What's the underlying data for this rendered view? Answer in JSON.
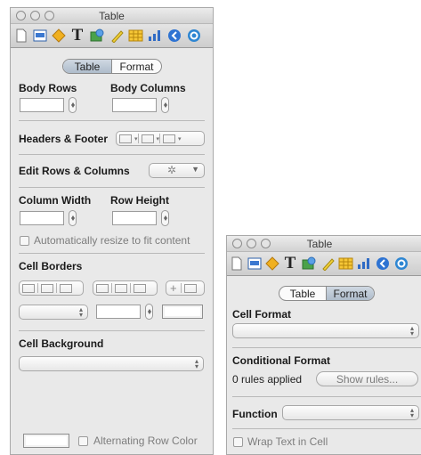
{
  "panel1": {
    "title": "Table",
    "tabs": [
      "Table",
      "Format"
    ],
    "selected_tab": "Table",
    "body_rows_label": "Body Rows",
    "body_rows_value": "",
    "body_columns_label": "Body Columns",
    "body_columns_value": "",
    "headers_footer_label": "Headers & Footer",
    "edit_rows_label": "Edit Rows & Columns",
    "column_width_label": "Column Width",
    "column_width_value": "",
    "row_height_label": "Row Height",
    "row_height_value": "",
    "auto_resize_label": "Automatically resize to fit content",
    "cell_borders_label": "Cell Borders",
    "border_width_value": "",
    "cell_background_label": "Cell Background",
    "alternating_label": "Alternating Row Color"
  },
  "panel2": {
    "title": "Table",
    "tabs": [
      "Table",
      "Format"
    ],
    "selected_tab": "Format",
    "cell_format_label": "Cell Format",
    "conditional_format_label": "Conditional Format",
    "rules_applied_text": "0 rules applied",
    "show_rules_label": "Show rules...",
    "function_label": "Function",
    "wrap_text_label": "Wrap Text in Cell"
  },
  "toolbar_icons": [
    "document-icon",
    "layout-icon",
    "graphic-icon",
    "text-icon",
    "wrap-icon",
    "shape-icon",
    "table-icon",
    "chart-icon",
    "link-icon",
    "metrics-icon"
  ],
  "colors": {
    "panel_bg": "#e9e9e9",
    "selected_tab": "#b9c6d3"
  }
}
